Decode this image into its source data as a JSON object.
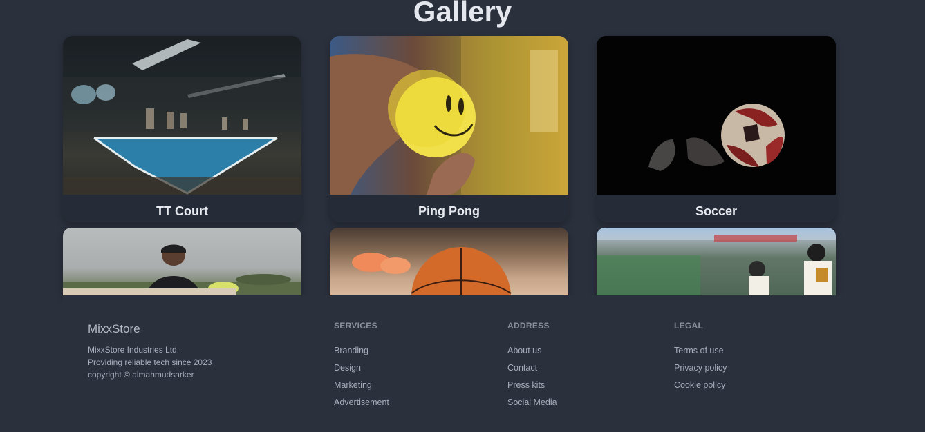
{
  "gallery": {
    "title": "Gallery",
    "cards": [
      {
        "label": "TT Court"
      },
      {
        "label": "Ping Pong"
      },
      {
        "label": "Soccer"
      }
    ]
  },
  "footer": {
    "brand": "MixxStore",
    "info": [
      "MixxStore Industries Ltd.",
      "Providing reliable tech since 2023",
      "copyright © almahmudsarker"
    ],
    "columns": [
      {
        "title": "SERVICES",
        "links": [
          "Branding",
          "Design",
          "Marketing",
          "Advertisement"
        ]
      },
      {
        "title": "ADDRESS",
        "links": [
          "About us",
          "Contact",
          "Press kits",
          "Social Media"
        ]
      },
      {
        "title": "LEGAL",
        "links": [
          "Terms of use",
          "Privacy policy",
          "Cookie policy"
        ]
      }
    ]
  }
}
